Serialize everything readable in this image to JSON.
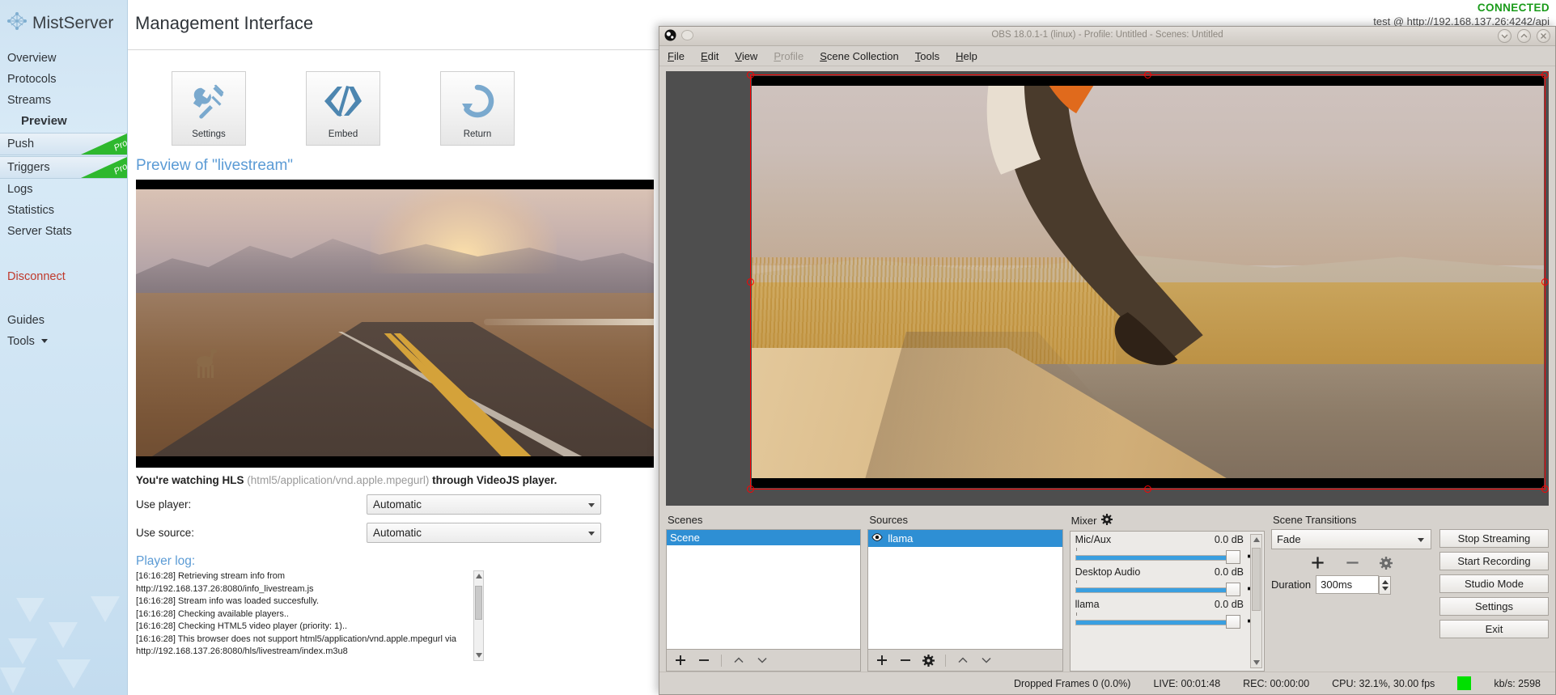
{
  "mistserver": {
    "logo_text": "MistServer",
    "logo_icon": "mistserver-logo-icon",
    "header_title": "Management Interface",
    "connection": {
      "status": "CONNECTED",
      "status_color": "#1a9b1a",
      "account_line": "test @ http://192.168.137.26:4242/api"
    },
    "sidebar": {
      "items": [
        {
          "label": "Overview",
          "type": "normal"
        },
        {
          "label": "Protocols",
          "type": "normal"
        },
        {
          "label": "Streams",
          "type": "normal"
        },
        {
          "label": "Preview",
          "type": "active"
        },
        {
          "label": "Push",
          "type": "pro",
          "badge": "Pro"
        },
        {
          "label": "Triggers",
          "type": "pro",
          "badge": "Pro"
        },
        {
          "label": "Logs",
          "type": "normal"
        },
        {
          "label": "Statistics",
          "type": "normal"
        },
        {
          "label": "Server Stats",
          "type": "normal"
        },
        {
          "label": "Disconnect",
          "type": "disconnect"
        },
        {
          "label": "Guides",
          "type": "normal"
        },
        {
          "label": "Tools",
          "type": "dropdown"
        }
      ]
    },
    "toolbar": [
      {
        "label": "Settings",
        "icon": "wrench-screwdriver-icon"
      },
      {
        "label": "Embed",
        "icon": "code-brackets-icon"
      },
      {
        "label": "Return",
        "icon": "circular-arrow-icon"
      }
    ],
    "preview": {
      "heading": "Preview of \"livestream\"",
      "watch_prefix": "You're watching HLS ",
      "watch_mime": "(html5/application/vnd.apple.mpegurl)",
      "watch_suffix": " through VideoJS player."
    },
    "fields": [
      {
        "label": "Use player:",
        "value": "Automatic"
      },
      {
        "label": "Use source:",
        "value": "Automatic"
      }
    ],
    "player_log": {
      "heading": "Player log:",
      "lines": [
        "[16:16:28]  Retrieving            stream            info            from",
        "http://192.168.137.26:8080/info_livestream.js",
        "[16:16:28]  Stream info was loaded succesfully.",
        "[16:16:28]  Checking available players..",
        "[16:16:28]  Checking HTML5 video player (priority: 1)..",
        "[16:16:28]  This browser does not support html5/application/vnd.apple.mpegurl via",
        "http://192.168.137.26:8080/hls/livestream/index.m3u8"
      ]
    }
  },
  "obs": {
    "title": "OBS 18.0.1-1 (linux) - Profile: Untitled - Scenes: Untitled",
    "app_icon": "obs-logo-icon",
    "menu": [
      {
        "label": "File",
        "mnemonic": "F",
        "disabled": false
      },
      {
        "label": "Edit",
        "mnemonic": "E",
        "disabled": false
      },
      {
        "label": "View",
        "mnemonic": "V",
        "disabled": false
      },
      {
        "label": "Profile",
        "mnemonic": "P",
        "disabled": true
      },
      {
        "label": "Scene Collection",
        "mnemonic": "S",
        "disabled": false
      },
      {
        "label": "Tools",
        "mnemonic": "T",
        "disabled": false
      },
      {
        "label": "Help",
        "mnemonic": "H",
        "disabled": false
      }
    ],
    "window_controls": [
      {
        "name": "minimize-button",
        "glyph": "⌄"
      },
      {
        "name": "maximize-button",
        "glyph": "⌃"
      },
      {
        "name": "close-button",
        "glyph": "×"
      }
    ],
    "scenes": {
      "title": "Scenes",
      "items": [
        "Scene"
      ],
      "tools": [
        "add",
        "remove",
        "move-up",
        "move-down"
      ]
    },
    "sources": {
      "title": "Sources",
      "items": [
        {
          "label": "llama",
          "visible": true
        }
      ],
      "tools": [
        "add",
        "remove",
        "properties",
        "move-up",
        "move-down"
      ]
    },
    "mixer": {
      "title": "Mixer",
      "settings_icon": "gear-icon",
      "channels": [
        {
          "name": "Mic/Aux",
          "level": "0.0 dB",
          "muted": false
        },
        {
          "name": "Desktop Audio",
          "level": "0.0 dB",
          "muted": false
        },
        {
          "name": "llama",
          "level": "0.0 dB",
          "muted": false
        }
      ]
    },
    "transitions": {
      "title": "Scene Transitions",
      "selected": "Fade",
      "duration_label": "Duration",
      "duration_value": "300ms",
      "tools": [
        "add",
        "remove",
        "properties"
      ]
    },
    "controls": [
      "Stop Streaming",
      "Start Recording",
      "Studio Mode",
      "Settings",
      "Exit"
    ],
    "status": {
      "dropped_frames": "Dropped Frames 0 (0.0%)",
      "live": "LIVE: 00:01:48",
      "rec": "REC: 00:00:00",
      "cpu": "CPU: 32.1%, 30.00 fps",
      "led_color": "#00e000",
      "kbps": "kb/s: 2598"
    }
  }
}
